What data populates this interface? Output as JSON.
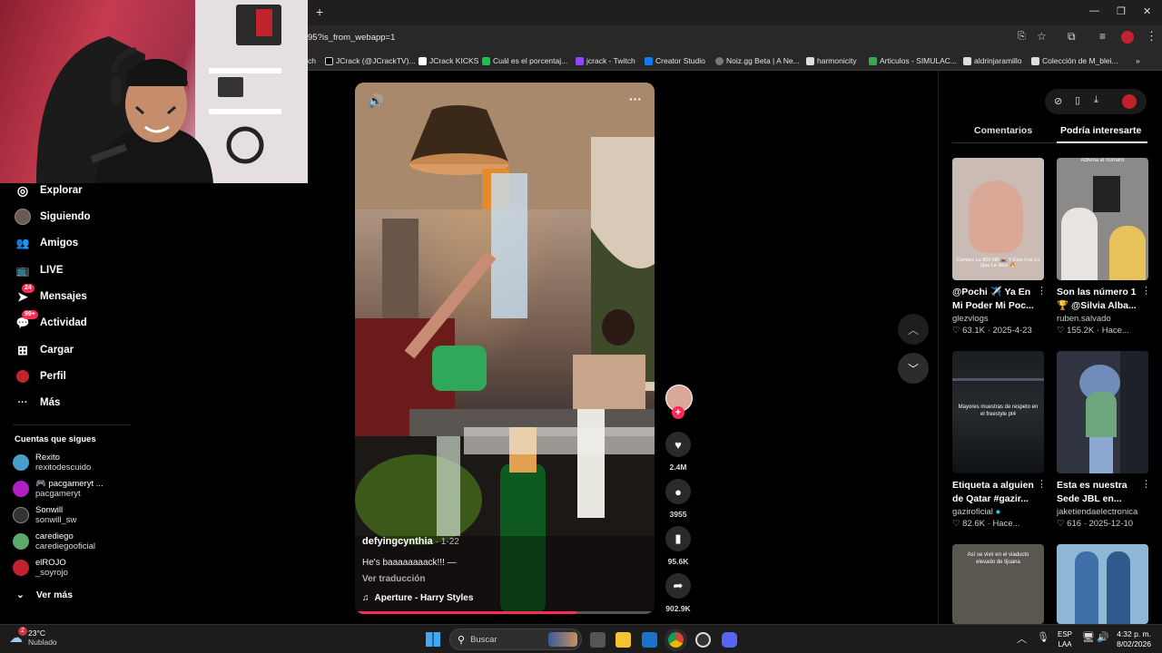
{
  "browser": {
    "new_tab": "+",
    "url": "95?is_from_webapp=1",
    "bookmarks": [
      {
        "label": "ch",
        "color": "#888888"
      },
      {
        "label": "JCrack (@JCrackTV)...",
        "color": "#000000"
      },
      {
        "label": "JCrack KICKS",
        "color": "#ffffff"
      },
      {
        "label": "Cuál es el porcentaj...",
        "color": "#1dbf4f"
      },
      {
        "label": "jcrack - Twitch",
        "color": "#9146ff"
      },
      {
        "label": "Creator Studio",
        "color": "#1877f2"
      },
      {
        "label": "Noiz.gg Beta | A Ne...",
        "color": "#777777"
      },
      {
        "label": "harmonicity",
        "color": "#dddddd"
      },
      {
        "label": "Articulos - SIMULAC...",
        "color": "#34a853"
      },
      {
        "label": "aldrinjaramillo",
        "color": "#dddddd"
      },
      {
        "label": "Colección de M_blei...",
        "color": "#dddddd"
      }
    ],
    "more_bookmarks": "»"
  },
  "sidebar": {
    "items": [
      {
        "label": "Explorar",
        "icon": "compass-icon",
        "glyph": "◎"
      },
      {
        "label": "Siguiendo",
        "icon": "avatar-icon",
        "glyph": ""
      },
      {
        "label": "Amigos",
        "icon": "friends-icon",
        "glyph": "👥"
      },
      {
        "label": "LIVE",
        "icon": "live-tv-icon",
        "glyph": "📺"
      },
      {
        "label": "Mensajes",
        "icon": "messages-icon",
        "glyph": "➤",
        "badge": "24"
      },
      {
        "label": "Actividad",
        "icon": "activity-icon",
        "glyph": "💬",
        "badge": "99+"
      },
      {
        "label": "Cargar",
        "icon": "upload-icon",
        "glyph": "⊞"
      },
      {
        "label": "Perfil",
        "icon": "profile-icon",
        "glyph": "●"
      },
      {
        "label": "Más",
        "icon": "more-dots-icon",
        "glyph": "···"
      }
    ],
    "following_title": "Cuentas que sigues",
    "accounts": [
      {
        "name": "Rexito",
        "handle": "rexitodescuido",
        "color": "#4a9cc9"
      },
      {
        "name": "🎮 pacgameryt ...",
        "handle": "pacgameryt",
        "color": "#b01ec4"
      },
      {
        "name": "Sonwill",
        "handle": "sonwill_sw",
        "color": "#333333"
      },
      {
        "name": "carediego",
        "handle": "carediegooficial",
        "color": "#5aa86a"
      },
      {
        "name": "elROJO",
        "handle": "_soyrojo",
        "color": "#c0232e"
      }
    ],
    "see_more": "Ver más"
  },
  "video": {
    "author": "defyingcynthia",
    "date": "· 1-22",
    "caption": "He's baaaaaaaack!!! —",
    "translate": "Ver traducción",
    "sound": "Aperture - Harry Styles",
    "progress": 0.74
  },
  "actions": {
    "likes": "2.4M",
    "comments": "3955",
    "saves": "95.6K",
    "shares": "902.9K"
  },
  "panel": {
    "tab_comments": "Comentarios",
    "tab_suggested": "Podría interesarte",
    "cards": [
      {
        "title": "@Pochi ✈️ Ya En Mi Poder Mi Poc...",
        "user": "glezvlogs",
        "likes": "63.1K",
        "date": "2025-4-23",
        "overlay": "Compre La 800 NR 🏍️ Y Esto Fue Lo Que Le Hice 🔥",
        "verified": false
      },
      {
        "title": "Son las número 1 🏆 @Silvia Alba...",
        "user": "ruben.salvado",
        "likes": "155.2K",
        "date": "Hace...",
        "overlay": "Adivina el número",
        "verified": false
      },
      {
        "title": "Etiqueta a alguien de Qatar #gazir...",
        "user": "gaziroficial",
        "likes": "82.6K",
        "date": "Hace...",
        "overlay": "Mayores muestras de respeto en el freestyle pt4",
        "verified": true
      },
      {
        "title": "Esta es nuestra Sede JBL en...",
        "user": "jaketiendaelectronica",
        "likes": "616",
        "date": "2025-12-10",
        "overlay": "",
        "verified": false
      },
      {
        "title": "",
        "user": "",
        "likes": "",
        "date": "",
        "overlay": "Así se vivir en el viaducto elevado de tijuana",
        "verified": false
      },
      {
        "title": "",
        "user": "",
        "likes": "",
        "date": "",
        "overlay": "",
        "verified": false
      }
    ]
  },
  "taskbar": {
    "weather_temp": "23°C",
    "weather_desc": "Nublado",
    "weather_badge": "2",
    "search": "Buscar",
    "lang1": "ESP",
    "lang2": "LAA",
    "time": "4:32 p. m.",
    "date": "8/02/2026"
  }
}
